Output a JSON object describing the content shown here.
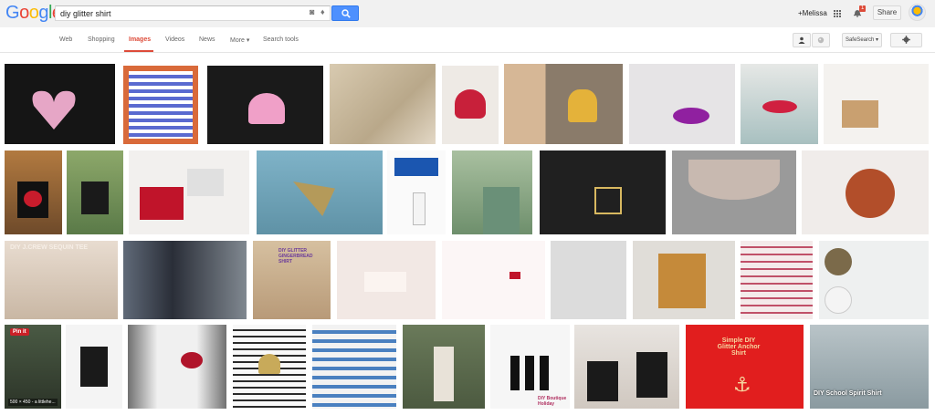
{
  "logo": {
    "letters": [
      {
        "ch": "G",
        "color": "#4285f4"
      },
      {
        "ch": "o",
        "color": "#ea4335"
      },
      {
        "ch": "o",
        "color": "#fbbc05"
      },
      {
        "ch": "g",
        "color": "#4285f4"
      },
      {
        "ch": "l",
        "color": "#34a853"
      },
      {
        "ch": "e",
        "color": "#ea4335"
      }
    ]
  },
  "search": {
    "query": "diy glitter shirt",
    "camera_icon": "camera-icon",
    "mic_icon": "mic-icon",
    "button_icon": "search-icon"
  },
  "header": {
    "user": "+Melissa",
    "notifications_count": "1",
    "share_label": "Share"
  },
  "tabs": [
    {
      "label": "Web",
      "active": false
    },
    {
      "label": "Shopping",
      "active": false
    },
    {
      "label": "Images",
      "active": true
    },
    {
      "label": "Videos",
      "active": false
    },
    {
      "label": "News",
      "active": false
    },
    {
      "label": "More ▾",
      "active": false
    },
    {
      "label": "Search tools",
      "active": false
    }
  ],
  "toolbar": {
    "safe_search_label": "SafeSearch ▾",
    "settings_icon": "gear-icon",
    "person_icon": "person-icon",
    "globe_icon": "globe-icon"
  },
  "image_captions": {
    "pin_badge": "Pin it",
    "dimensions": "500 × 450 - a littlehe...",
    "crew_sequin": "DIY J.CREW SEQUIN TEE",
    "gingerbread": "DIY GLITTER GINGERBREAD SHIRT",
    "boutique": "DIY Boutique Holiday",
    "anchor": "Simple DIY Glitter Anchor Shirt",
    "school_spirit": "DIY School Spirit Shirt"
  },
  "colors": {
    "accent": "#dd4b39",
    "search_blue": "#4d90fe",
    "topbar": "#f1f1f1"
  }
}
